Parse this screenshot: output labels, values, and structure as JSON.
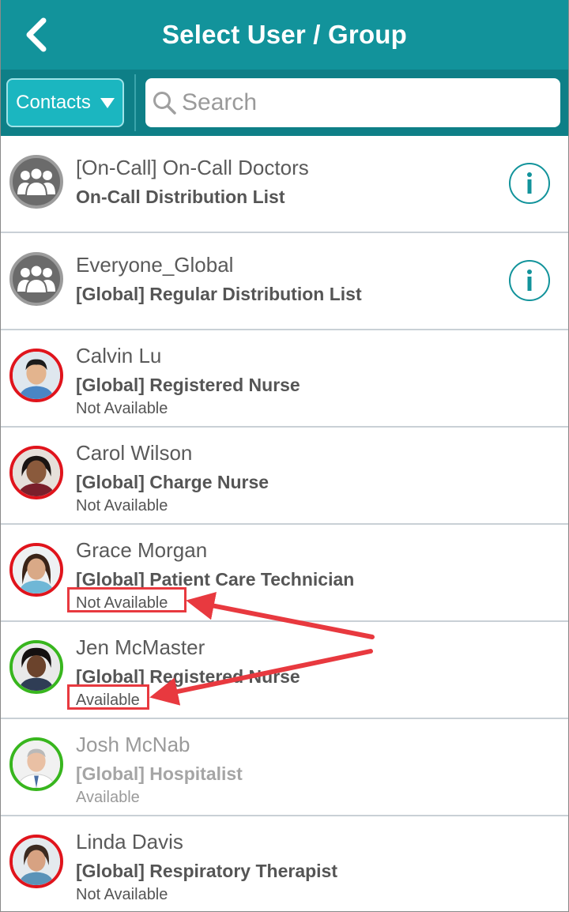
{
  "header": {
    "title": "Select User / Group"
  },
  "toolbar": {
    "filter_label": "Contacts",
    "search_placeholder": "Search"
  },
  "colors": {
    "header": "#12939b",
    "toolbar": "#0e7f87",
    "accent": "#1bb6c0",
    "unavailable": "#e0141c",
    "available": "#38b61e",
    "annotation": "#e8393f"
  },
  "groups": [
    {
      "name": "[On-Call] On-Call Doctors",
      "role": "On-Call Distribution List",
      "icon": "group-icon"
    },
    {
      "name": "Everyone_Global",
      "role": "[Global] Regular Distribution List",
      "icon": "group-icon"
    }
  ],
  "contacts": [
    {
      "name": "Calvin Lu",
      "role": "[Global] Registered Nurse",
      "status": "Not Available"
    },
    {
      "name": "Carol Wilson",
      "role": "[Global] Charge Nurse",
      "status": "Not Available"
    },
    {
      "name": "Grace Morgan",
      "role": "[Global] Patient Care Technician",
      "status": "Not Available"
    },
    {
      "name": "Jen McMaster",
      "role": "[Global] Registered Nurse",
      "status": "Available"
    },
    {
      "name": "Josh McNab",
      "role": "[Global] Hospitalist",
      "status": "Available"
    },
    {
      "name": "Linda Davis",
      "role": "[Global] Respiratory Therapist",
      "status": "Not Available"
    }
  ]
}
